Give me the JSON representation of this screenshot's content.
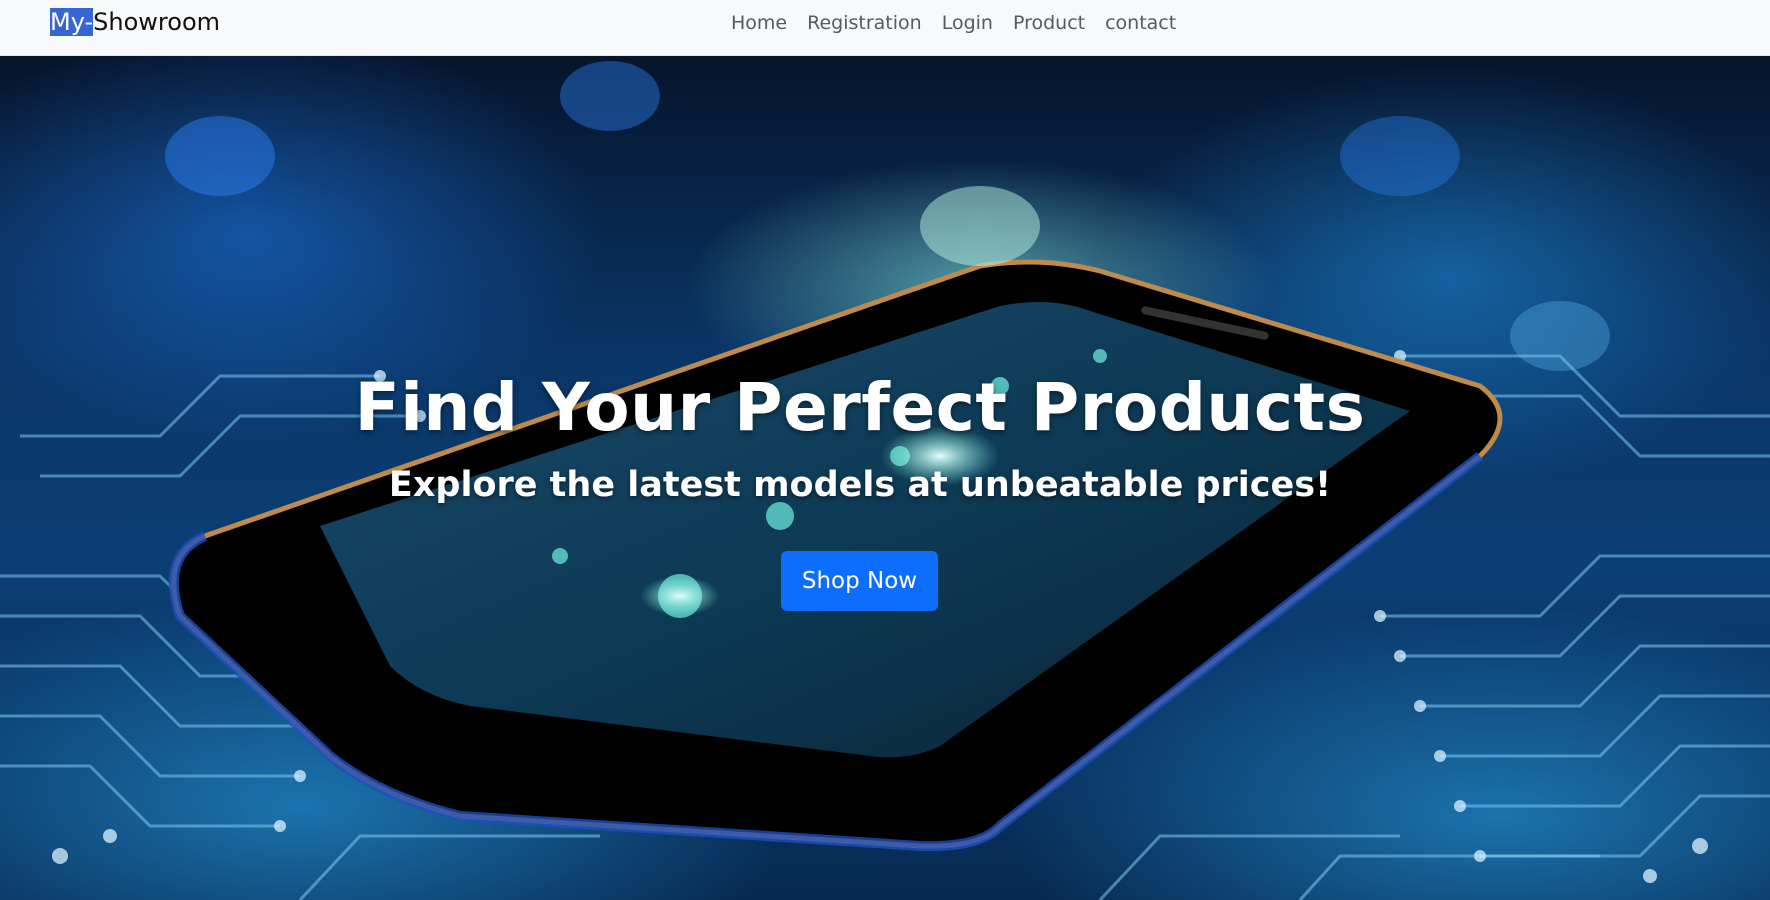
{
  "brand": {
    "highlight": "My-",
    "rest": "Showroom"
  },
  "nav": {
    "items": [
      {
        "label": "Home"
      },
      {
        "label": "Registration"
      },
      {
        "label": "Login"
      },
      {
        "label": "Product"
      },
      {
        "label": "contact"
      }
    ]
  },
  "hero": {
    "title": "Find Your Perfect Products",
    "subtitle": "Explore the latest models at unbeatable prices!",
    "cta_label": "Shop Now",
    "image_icon": "smartphone-circuit-board-image"
  },
  "colors": {
    "navbar_bg": "#f8f9fa",
    "brand_highlight": "#3666d6",
    "cta_bg": "#0d6efd",
    "hero_text": "#ffffff"
  }
}
